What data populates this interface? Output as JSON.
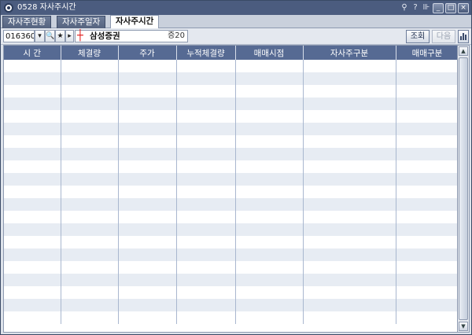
{
  "window": {
    "title": "0528 자사주시간",
    "tools": [
      "⚲",
      "?",
      "⊪"
    ],
    "controls": {
      "minimize": "_",
      "maximize": "□",
      "close": "×"
    }
  },
  "tabs": [
    {
      "label": "자사주현황",
      "active": false
    },
    {
      "label": "자사주일자",
      "active": false
    },
    {
      "label": "자사주시간",
      "active": true
    }
  ],
  "toolbar": {
    "code_value": "016360",
    "dropdown_glyph": "▾",
    "search_glyph": "🔍",
    "favorite_glyph": "★",
    "next_glyph": "▸",
    "stock_icon_glyph": "┼",
    "stock_name": "삼성증권",
    "margin_label": "증20",
    "query_label": "조회",
    "next_label": "다음"
  },
  "grid": {
    "columns": [
      "시 간",
      "체결량",
      "주가",
      "누적체결량",
      "매매시점",
      "자사주구분",
      "매매구분"
    ],
    "row_count": 21
  },
  "scrollbar": {
    "up": "▲",
    "down": "▼"
  },
  "colors": {
    "titlebar": "#4b5c7f",
    "header": "#566a93",
    "row_alt": "#e7ecf3",
    "stock_icon": "#e01818"
  }
}
